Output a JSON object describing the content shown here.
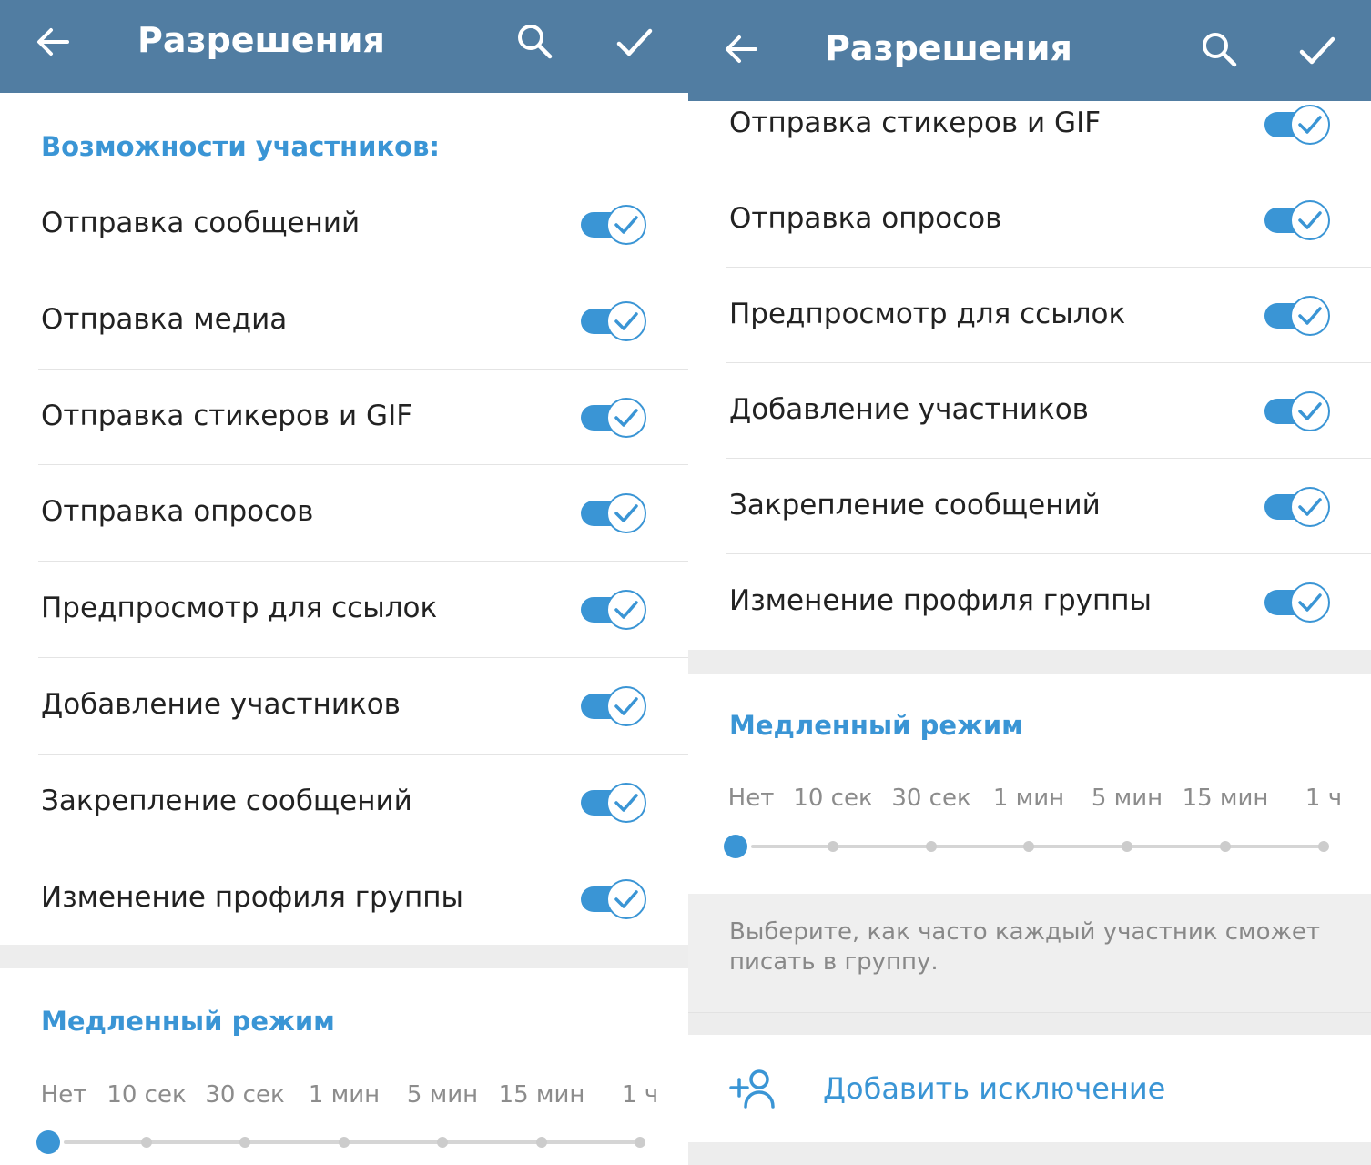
{
  "app_bar": {
    "title": "Разрешения"
  },
  "sections": {
    "permissions_header": "Возможности участников:",
    "slow_mode_header": "Медленный режим"
  },
  "permissions": [
    {
      "label": "Отправка сообщений",
      "enabled": true
    },
    {
      "label": "Отправка медиа",
      "enabled": true
    },
    {
      "label": "Отправка стикеров и GIF",
      "enabled": true
    },
    {
      "label": "Отправка опросов",
      "enabled": true
    },
    {
      "label": "Предпросмотр для ссылок",
      "enabled": true
    },
    {
      "label": "Добавление участников",
      "enabled": true
    },
    {
      "label": "Закрепление сообщений",
      "enabled": true
    },
    {
      "label": "Изменение профиля группы",
      "enabled": true
    }
  ],
  "slow_mode": {
    "options": [
      "Нет",
      "10 сек",
      "30 сек",
      "1 мин",
      "5 мин",
      "15 мин",
      "1 ч"
    ],
    "selected": "Нет",
    "hint": "Выберите, как часто каждый участник сможет писать в группу."
  },
  "exceptions": {
    "add_label": "Добавить исключение"
  },
  "icons": {
    "back": "arrow-left-icon",
    "search": "search-icon",
    "confirm": "check-icon",
    "toggle_on": "check-icon",
    "add_exception": "add-user-icon"
  },
  "colors": {
    "app_bar": "#517DA2",
    "accent": "#3A95D5",
    "text_primary": "#222222",
    "text_secondary": "#888888",
    "divider": "#E4E4E4",
    "section_gap": "#EDEDED"
  }
}
